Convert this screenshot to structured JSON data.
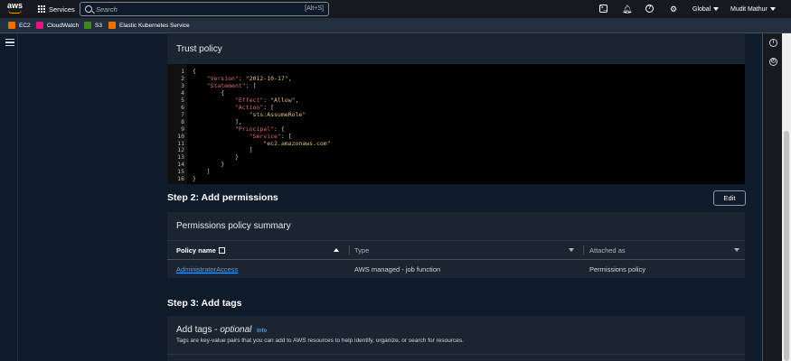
{
  "topnav": {
    "logo": "aws",
    "services_label": "Services",
    "search_placeholder": "Search",
    "search_shortcut": "[Alt+S]",
    "region_label": "Global",
    "user_label": "Mudit Mathur"
  },
  "favorites": [
    {
      "label": "EC2",
      "color": "#ed7100"
    },
    {
      "label": "CloudWatch",
      "color": "#e7157b"
    },
    {
      "label": "S3",
      "color": "#3f8624"
    },
    {
      "label": "Elastic Kubernetes Service",
      "color": "#ed7100"
    }
  ],
  "trust_policy": {
    "title": "Trust policy",
    "lines": [
      {
        "n": "1",
        "t": "{"
      },
      {
        "n": "2",
        "t": "    \"Version\": \"2012-10-17\","
      },
      {
        "n": "3",
        "t": "    \"Statement\": ["
      },
      {
        "n": "4",
        "t": "        {"
      },
      {
        "n": "5",
        "t": "            \"Effect\": \"Allow\","
      },
      {
        "n": "6",
        "t": "            \"Action\": ["
      },
      {
        "n": "7",
        "t": "                \"sts:AssumeRole\""
      },
      {
        "n": "8",
        "t": "            ],"
      },
      {
        "n": "9",
        "t": "            \"Principal\": {"
      },
      {
        "n": "10",
        "t": "                \"Service\": ["
      },
      {
        "n": "11",
        "t": "                    \"ec2.amazonaws.com\""
      },
      {
        "n": "12",
        "t": "                ]"
      },
      {
        "n": "13",
        "t": "            }"
      },
      {
        "n": "14",
        "t": "        }"
      },
      {
        "n": "15",
        "t": "    ]"
      },
      {
        "n": "16",
        "t": "}"
      }
    ]
  },
  "step2": {
    "heading": "Step 2: Add permissions",
    "edit_label": "Edit",
    "summary_title": "Permissions policy summary",
    "columns": [
      "Policy name",
      "Type",
      "Attached as"
    ],
    "row": {
      "policy_name": "AdministratorAccess",
      "type": "AWS managed - job function",
      "attached_as": "Permissions policy"
    }
  },
  "step3": {
    "heading": "Step 3: Add tags",
    "tags_title": "Add tags - ",
    "tags_optional": "optional",
    "info_label": "Info",
    "tags_description": "Tags are key-value pairs that you can add to AWS resources to help identify, organize, or search for resources."
  },
  "colors": {
    "link": "#539fe5",
    "json_key": "#e06c75",
    "json_string": "#e5c07b"
  }
}
